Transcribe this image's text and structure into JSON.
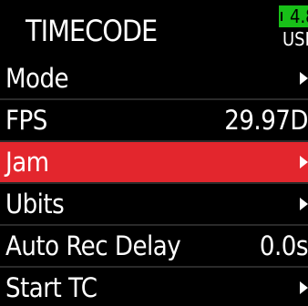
{
  "header": {
    "title": "TIMECODE",
    "battery": {
      "level_text": "4.8",
      "source": "USB",
      "color": "#18c018"
    }
  },
  "menu": {
    "selected_color": "#e3262d",
    "items": [
      {
        "label": "Mode",
        "value": "",
        "arrow_icon": "chevron-right-icon",
        "selected": false
      },
      {
        "label": "FPS",
        "value": "29.97D",
        "arrow_icon": "",
        "selected": false
      },
      {
        "label": "Jam",
        "value": "",
        "arrow_icon": "chevron-right-icon",
        "selected": true
      },
      {
        "label": "Ubits",
        "value": "",
        "arrow_icon": "chevron-right-icon",
        "selected": false
      },
      {
        "label": "Auto Rec Delay",
        "value": "0.0s",
        "arrow_icon": "",
        "selected": false
      },
      {
        "label": "Start TC",
        "value": "",
        "arrow_icon": "chevron-right-icon",
        "selected": false
      }
    ]
  }
}
